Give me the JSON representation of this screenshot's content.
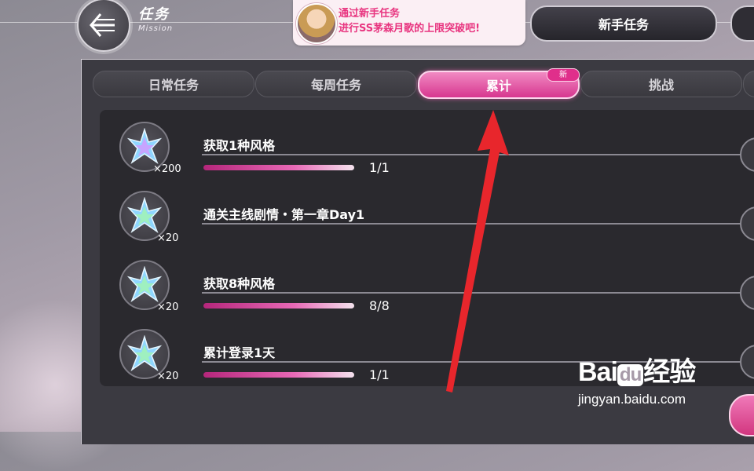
{
  "header": {
    "title_zh": "任务",
    "title_en": "Mission",
    "notice_line1": "通过新手任务",
    "notice_line2": "进行SS茅森月歌的上限突破吧!",
    "newbie_tab": "新手任务"
  },
  "tabs": [
    {
      "label": "日常任务",
      "active": false
    },
    {
      "label": "每周任务",
      "active": false
    },
    {
      "label": "累计",
      "active": true
    },
    {
      "label": "挑战",
      "active": false
    }
  ],
  "new_badge": "新",
  "missions": [
    {
      "name": "获取1种风格",
      "reward_qty": "×200",
      "progress": "1/1",
      "progress_fraction": 1.0
    },
    {
      "name": "通关主线剧情・第一章Day1",
      "reward_qty": "×20",
      "progress": "",
      "progress_fraction": null
    },
    {
      "name": "获取8种风格",
      "reward_qty": "×20",
      "progress": "8/8",
      "progress_fraction": 1.0
    },
    {
      "name": "累计登录1天",
      "reward_qty": "×20",
      "progress": "1/1",
      "progress_fraction": 1.0
    }
  ],
  "watermark": {
    "logo_a": "Bai",
    "logo_b": "du",
    "logo_c": "经验",
    "url": "jingyan.baidu.com"
  },
  "colors": {
    "accent_pink": "#e02f8b",
    "annotation_arrow": "#e8262c"
  }
}
